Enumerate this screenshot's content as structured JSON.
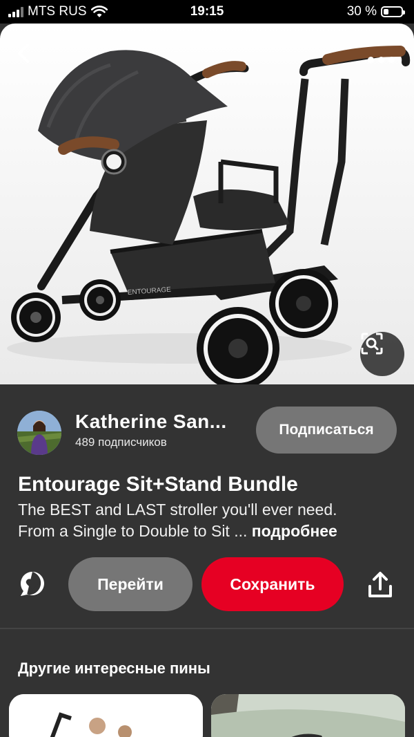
{
  "status_bar": {
    "carrier": "MTS RUS",
    "time": "19:15",
    "battery": "30 %",
    "battery_level": 0.3
  },
  "hero": {
    "brand_text": "ENTOURAGE",
    "icons": {
      "back": "back-arrow-icon",
      "more": "more-dots-icon",
      "lens": "visual-search-icon"
    }
  },
  "creator": {
    "name": "Katherine San...",
    "followers": "489 подписчиков",
    "follow_label": "Подписаться"
  },
  "pin": {
    "title": "Entourage Sit+Stand Bundle",
    "description_line1": "The BEST and LAST stroller you'll ever need.",
    "description_line2": "From a Single to Double to Sit ...",
    "more_link": "подробнее"
  },
  "actions": {
    "go_label": "Перейти",
    "save_label": "Сохранить",
    "save_color": "#e60023",
    "icons": {
      "comment": "comment-bubble-icon",
      "share": "share-upload-icon"
    }
  },
  "more_pins": {
    "title": "Другие интересные пины"
  }
}
